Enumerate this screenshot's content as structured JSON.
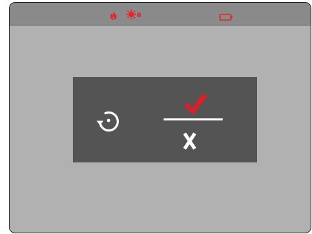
{
  "status_bar": {
    "icons": [
      "fire-icon",
      "sun-icon",
      "battery-icon"
    ],
    "sun_badge_text": "B",
    "icon_color": "#e3262f"
  },
  "dialog": {
    "rotate_icon": "rotate-icon",
    "confirm_icon": "checkmark-icon",
    "cancel_icon": "x-icon",
    "confirm_color": "#d4212b",
    "icon_color": "#ffffff"
  },
  "colors": {
    "background": "#b1b1b1",
    "status_bar": "#8a8a8a",
    "dialog": "#545454",
    "accent": "#e3262f"
  }
}
